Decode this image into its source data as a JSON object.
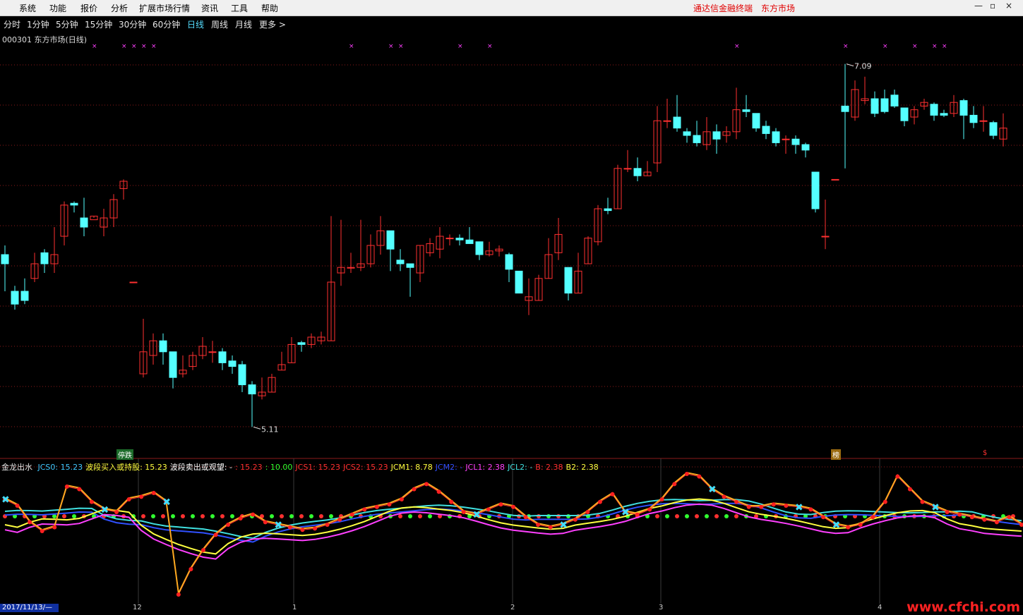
{
  "menu": {
    "items": [
      "系统",
      "功能",
      "报价",
      "分析",
      "扩展市场行情",
      "资讯",
      "工具",
      "帮助"
    ],
    "brand": "通达信金融终端",
    "market": "东方市场"
  },
  "window_controls": [
    "—",
    "▫",
    "×"
  ],
  "periods": {
    "items": [
      "分时",
      "1分钟",
      "5分钟",
      "15分钟",
      "30分钟",
      "60分钟",
      "日线",
      "周线",
      "月线",
      "更多 >"
    ],
    "active_index": 6
  },
  "stock": {
    "title": "000301 东方市场(日线)",
    "high_label": "7.09",
    "low_label": "5.11"
  },
  "tags": {
    "limit_down": "停跌",
    "rank": "榜",
    "dollar": "$"
  },
  "indicator": {
    "name": "金龙出水",
    "items": [
      {
        "text": "JCS0: 15.23",
        "color": "#40c8ff"
      },
      {
        "text": "波段买入或持股: 15.23",
        "color": "#ffff40"
      },
      {
        "text": "波段卖出或观望: -",
        "color": "#ffffff"
      },
      {
        "text": ": 15.23",
        "color": "#ff3030"
      },
      {
        "text": ": 10.00",
        "color": "#30ff30"
      },
      {
        "text": "JCS1: 15.23",
        "color": "#ff3030"
      },
      {
        "text": "JCS2: 15.23",
        "color": "#ff3030"
      },
      {
        "text": "JCM1: 8.78",
        "color": "#ffff40"
      },
      {
        "text": "JCM2: -",
        "color": "#3050ff"
      },
      {
        "text": "JCL1: 2.38",
        "color": "#ff40ff"
      },
      {
        "text": "JCL2: -",
        "color": "#40e0e0"
      },
      {
        "text": "B: 2.38",
        "color": "#ff3030"
      },
      {
        "text": "B2: 2.38",
        "color": "#ffff40"
      }
    ]
  },
  "date_axis": {
    "current": "2017/11/13/—",
    "months": [
      {
        "label": "12"
      },
      {
        "label": "1"
      },
      {
        "label": "2"
      },
      {
        "label": "3"
      },
      {
        "label": "4"
      }
    ]
  },
  "watermark": "www.cfchi.com",
  "colors": {
    "up": "#ff3030",
    "down": "#54ffff",
    "grid": "#8b1a1a",
    "signal_x": "#ff40ff"
  },
  "chart_data": {
    "type": "candlestick",
    "symbol": "000301",
    "name": "东方市场",
    "period": "日线",
    "ylim": [
      5.0,
      7.2
    ],
    "max_marker": 7.09,
    "min_marker": 5.11,
    "candles": [
      [
        6.05,
        6.0,
        6.1,
        5.85
      ],
      [
        5.85,
        5.78,
        5.88,
        5.75
      ],
      [
        5.85,
        5.8,
        5.92,
        5.78
      ],
      [
        5.92,
        6.0,
        6.06,
        5.9
      ],
      [
        6.06,
        6.0,
        6.08,
        5.95
      ],
      [
        6.0,
        6.05,
        6.2,
        5.95
      ],
      [
        6.15,
        6.32,
        6.34,
        6.1
      ],
      [
        6.33,
        6.32,
        6.34,
        6.28
      ],
      [
        6.25,
        6.2,
        6.36,
        6.15
      ],
      [
        6.24,
        6.26,
        6.26,
        6.25
      ],
      [
        6.2,
        6.25,
        6.3,
        6.15
      ],
      [
        6.25,
        6.35,
        6.38,
        6.2
      ],
      [
        6.41,
        6.45,
        6.46,
        6.35
      ],
      [
        5.9,
        5.9,
        5.9,
        5.9
      ],
      [
        5.4,
        5.52,
        5.7,
        5.38
      ],
      [
        5.5,
        5.58,
        5.62,
        5.45
      ],
      [
        5.58,
        5.52,
        5.62,
        5.45
      ],
      [
        5.52,
        5.38,
        5.52,
        5.32
      ],
      [
        5.4,
        5.42,
        5.5,
        5.38
      ],
      [
        5.44,
        5.5,
        5.52,
        5.42
      ],
      [
        5.5,
        5.55,
        5.6,
        5.48
      ],
      [
        5.52,
        5.52,
        5.58,
        5.46
      ],
      [
        5.52,
        5.46,
        5.54,
        5.42
      ],
      [
        5.47,
        5.44,
        5.5,
        5.4
      ],
      [
        5.45,
        5.34,
        5.47,
        5.3
      ],
      [
        5.34,
        5.29,
        5.36,
        5.11
      ],
      [
        5.28,
        5.3,
        5.38,
        5.26
      ],
      [
        5.3,
        5.38,
        5.4,
        5.3
      ],
      [
        5.42,
        5.45,
        5.52,
        5.42
      ],
      [
        5.46,
        5.56,
        5.6,
        5.46
      ],
      [
        5.57,
        5.56,
        5.58,
        5.52
      ],
      [
        5.56,
        5.6,
        5.62,
        5.54
      ],
      [
        5.58,
        5.6,
        5.63,
        5.56
      ],
      [
        5.58,
        5.9,
        6.26,
        5.58
      ],
      [
        5.95,
        5.98,
        6.24,
        5.88
      ],
      [
        5.98,
        5.98,
        6.06,
        5.95
      ],
      [
        5.98,
        6.0,
        6.24,
        5.96
      ],
      [
        6.0,
        6.1,
        6.16,
        5.98
      ],
      [
        6.1,
        6.18,
        6.26,
        6.05
      ],
      [
        6.18,
        6.08,
        6.18,
        5.96
      ],
      [
        6.02,
        6.0,
        6.08,
        5.96
      ],
      [
        6.0,
        5.98,
        6.0,
        5.82
      ],
      [
        5.95,
        6.1,
        6.1,
        5.9
      ],
      [
        6.06,
        6.11,
        6.14,
        6.04
      ],
      [
        6.08,
        6.15,
        6.2,
        6.03
      ],
      [
        6.14,
        6.14,
        6.16,
        6.1
      ],
      [
        6.14,
        6.13,
        6.16,
        6.1
      ],
      [
        6.13,
        6.11,
        6.2,
        6.11
      ],
      [
        6.12,
        6.05,
        6.12,
        6.02
      ],
      [
        6.05,
        6.07,
        6.12,
        6.04
      ],
      [
        6.07,
        6.08,
        6.1,
        6.04
      ],
      [
        6.05,
        5.97,
        6.06,
        5.9
      ],
      [
        5.96,
        5.84,
        5.96,
        5.84
      ],
      [
        5.8,
        5.82,
        5.92,
        5.72
      ],
      [
        5.8,
        5.92,
        5.94,
        5.8
      ],
      [
        5.92,
        6.05,
        6.14,
        5.92
      ],
      [
        6.06,
        6.16,
        6.25,
        6.02
      ],
      [
        5.98,
        5.84,
        5.98,
        5.8
      ],
      [
        5.84,
        5.96,
        6.06,
        5.84
      ],
      [
        6.0,
        6.14,
        6.15,
        6.0
      ],
      [
        6.12,
        6.3,
        6.32,
        6.1
      ],
      [
        6.3,
        6.29,
        6.36,
        6.27
      ],
      [
        6.3,
        6.52,
        6.54,
        6.3
      ],
      [
        6.52,
        6.52,
        6.62,
        6.5
      ],
      [
        6.52,
        6.48,
        6.58,
        6.45
      ],
      [
        6.48,
        6.5,
        6.56,
        6.48
      ],
      [
        6.55,
        6.78,
        6.86,
        6.5
      ],
      [
        6.78,
        6.78,
        6.9,
        6.74
      ],
      [
        6.8,
        6.74,
        6.92,
        6.72
      ],
      [
        6.72,
        6.7,
        6.74,
        6.66
      ],
      [
        6.7,
        6.66,
        6.78,
        6.64
      ],
      [
        6.65,
        6.72,
        6.8,
        6.62
      ],
      [
        6.72,
        6.68,
        6.76,
        6.6
      ],
      [
        6.7,
        6.72,
        6.75,
        6.66
      ],
      [
        6.72,
        6.84,
        6.96,
        6.68
      ],
      [
        6.84,
        6.83,
        6.92,
        6.8
      ],
      [
        6.82,
        6.74,
        6.82,
        6.72
      ],
      [
        6.75,
        6.71,
        6.78,
        6.68
      ],
      [
        6.72,
        6.66,
        6.74,
        6.64
      ],
      [
        6.68,
        6.68,
        6.7,
        6.6
      ],
      [
        6.68,
        6.65,
        6.7,
        6.6
      ],
      [
        6.65,
        6.62,
        6.66,
        6.58
      ],
      [
        6.5,
        6.3,
        6.5,
        6.28
      ],
      [
        6.15,
        6.15,
        6.35,
        6.08
      ],
      [
        6.46,
        6.46,
        6.46,
        6.46
      ],
      [
        6.86,
        6.83,
        7.09,
        6.52
      ],
      [
        6.8,
        6.95,
        7.0,
        6.78
      ],
      [
        6.89,
        6.9,
        7.02,
        6.87
      ],
      [
        6.9,
        6.82,
        6.94,
        6.8
      ],
      [
        6.9,
        6.83,
        6.95,
        6.82
      ],
      [
        6.92,
        6.86,
        6.95,
        6.85
      ],
      [
        6.85,
        6.78,
        6.85,
        6.75
      ],
      [
        6.8,
        6.84,
        6.86,
        6.76
      ],
      [
        6.86,
        6.88,
        6.9,
        6.84
      ],
      [
        6.87,
        6.81,
        6.88,
        6.78
      ],
      [
        6.82,
        6.81,
        6.84,
        6.8
      ],
      [
        6.82,
        6.88,
        6.92,
        6.8
      ],
      [
        6.89,
        6.81,
        6.9,
        6.68
      ],
      [
        6.81,
        6.77,
        6.86,
        6.74
      ],
      [
        6.78,
        6.78,
        6.86,
        6.72
      ],
      [
        6.77,
        6.7,
        6.78,
        6.68
      ],
      [
        6.68,
        6.74,
        6.82,
        6.64
      ]
    ],
    "indicator_lines": {
      "JCS": [
        0.8,
        0.75,
        0.62,
        0.55,
        0.58,
        0.9,
        0.88,
        0.78,
        0.72,
        0.7,
        0.8,
        0.82,
        0.85,
        0.78,
        0.05,
        0.25,
        0.4,
        0.52,
        0.6,
        0.65,
        0.68,
        0.62,
        0.6,
        0.58,
        0.56,
        0.57,
        0.6,
        0.64,
        0.68,
        0.72,
        0.74,
        0.76,
        0.8,
        0.88,
        0.92,
        0.86,
        0.78,
        0.7,
        0.68,
        0.72,
        0.76,
        0.74,
        0.66,
        0.6,
        0.58,
        0.6,
        0.64,
        0.7,
        0.78,
        0.84,
        0.7,
        0.68,
        0.72,
        0.8,
        0.92,
        1.0,
        0.98,
        0.88,
        0.82,
        0.78,
        0.74,
        0.74,
        0.76,
        0.75,
        0.74,
        0.72,
        0.66,
        0.6,
        0.58,
        0.6,
        0.66,
        0.78,
        0.98,
        0.88,
        0.78,
        0.74,
        0.7,
        0.68,
        0.66,
        0.64,
        0.62,
        0.66,
        0.6
      ]
    }
  }
}
